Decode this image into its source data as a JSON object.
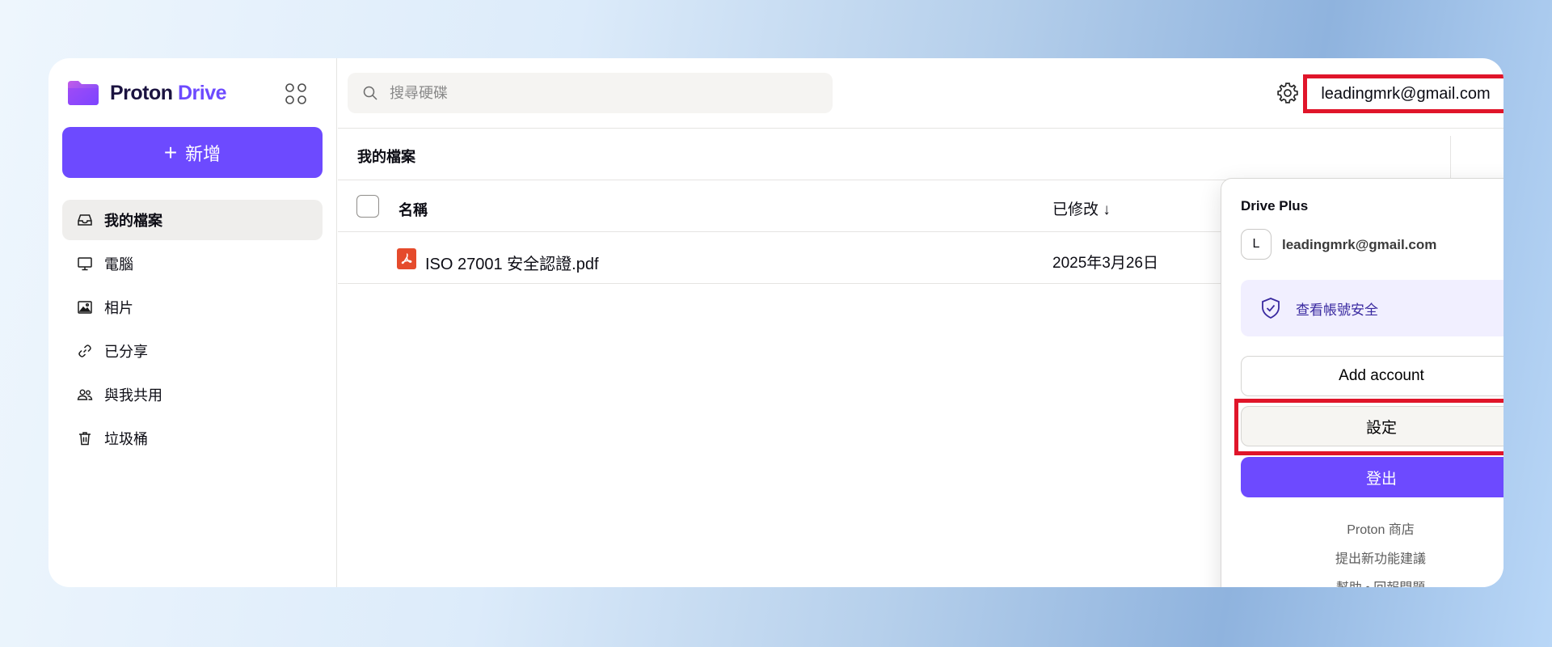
{
  "app": {
    "logo_word1": "Proton",
    "logo_word2": "Drive",
    "brand_color": "#6d4aff"
  },
  "sidebar": {
    "new_label": "新增",
    "items": [
      {
        "label": "我的檔案",
        "icon": "inbox-icon",
        "active": true
      },
      {
        "label": "電腦",
        "icon": "monitor-icon"
      },
      {
        "label": "相片",
        "icon": "image-icon"
      },
      {
        "label": "已分享",
        "icon": "link-icon"
      },
      {
        "label": "與我共用",
        "icon": "users-icon"
      },
      {
        "label": "垃圾桶",
        "icon": "trash-icon"
      }
    ]
  },
  "header": {
    "search_placeholder": "搜尋硬碟",
    "email": "leadingmrk@gmail.com",
    "avatar_initial": "L"
  },
  "main": {
    "title": "我的檔案",
    "columns": {
      "name": "名稱",
      "modified": "已修改 ↓"
    },
    "files": [
      {
        "name": "ISO 27001 安全認證.pdf",
        "modified": "2025年3月26日",
        "icon": "pdf-icon"
      }
    ]
  },
  "dropdown": {
    "plan": "Drive Plus",
    "avatar_initial": "L",
    "email": "leadingmrk@gmail.com",
    "security_label": "查看帳號安全",
    "add_account": "Add account",
    "settings": "設定",
    "sign_out": "登出",
    "links": [
      "Proton 商店",
      "提出新功能建議",
      "幫助 • 回報問題"
    ]
  },
  "highlight_color": "#e0152a"
}
